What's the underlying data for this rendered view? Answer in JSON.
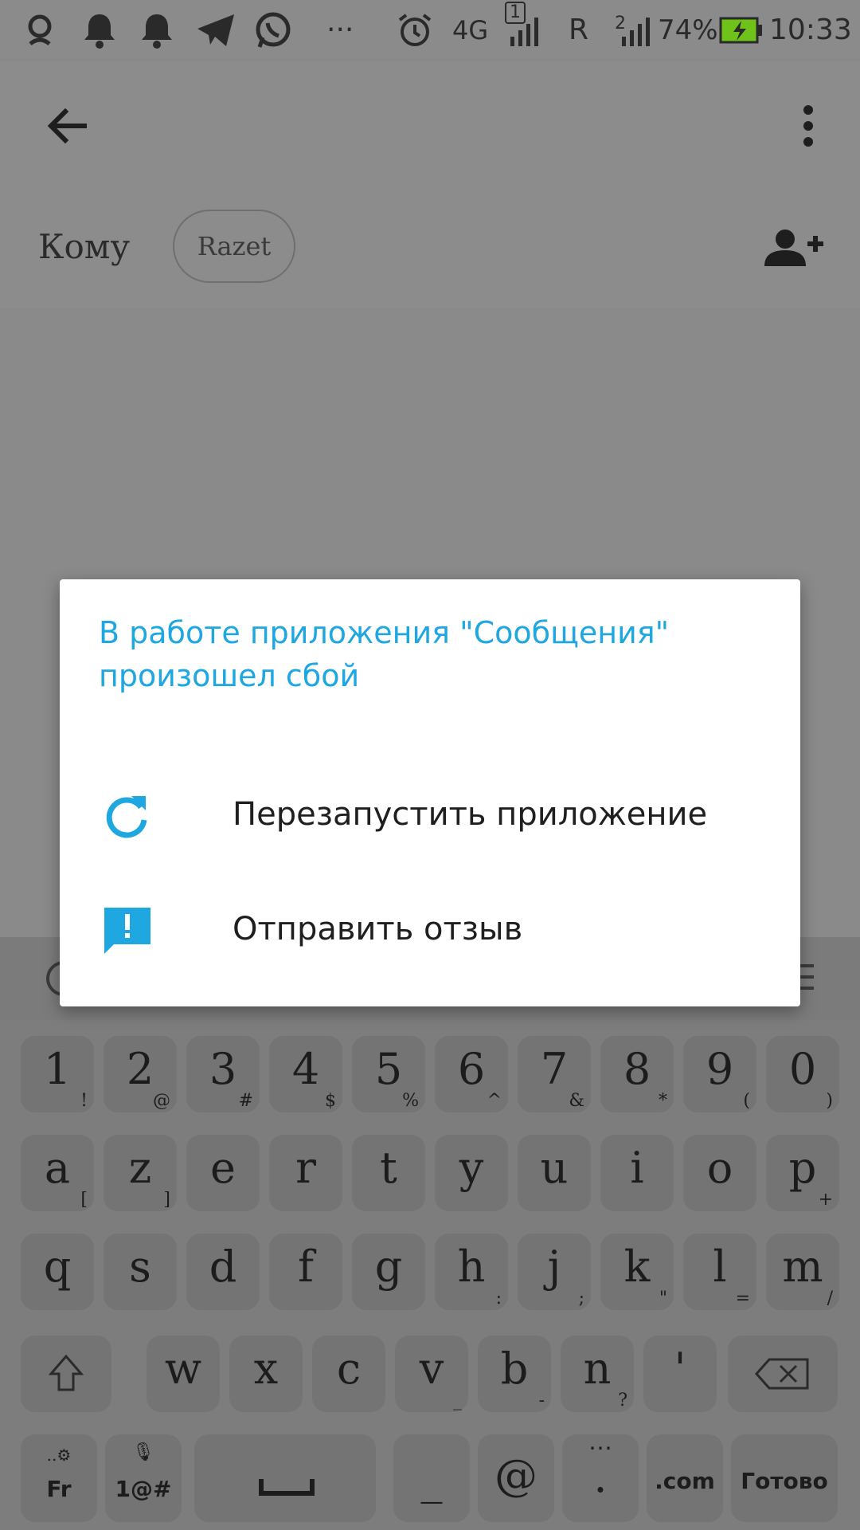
{
  "status_bar": {
    "network": "4G",
    "sim1_badge": "1",
    "roaming": "R",
    "sim2_badge": "2",
    "battery_percent": "74%",
    "time": "10:33",
    "overflow": "···"
  },
  "app_bar": {
    "to_label": "Кому",
    "recipient": "Razet"
  },
  "dialog": {
    "title": "В работе приложения \"Сообщения\" произошел сбой",
    "items": [
      {
        "label": "Перезапустить приложение",
        "icon": "refresh-icon"
      },
      {
        "label": "Отправить отзыв",
        "icon": "feedback-icon"
      }
    ],
    "accent_color": "#1ea7e0"
  },
  "keyboard": {
    "row1": [
      {
        "main": "1",
        "sub": "!"
      },
      {
        "main": "2",
        "sub": "@"
      },
      {
        "main": "3",
        "sub": "#"
      },
      {
        "main": "4",
        "sub": "$"
      },
      {
        "main": "5",
        "sub": "%"
      },
      {
        "main": "6",
        "sub": "^"
      },
      {
        "main": "7",
        "sub": "&"
      },
      {
        "main": "8",
        "sub": "*"
      },
      {
        "main": "9",
        "sub": "("
      },
      {
        "main": "0",
        "sub": ")"
      }
    ],
    "row2": [
      {
        "main": "a",
        "sub": "["
      },
      {
        "main": "z",
        "sub": "]"
      },
      {
        "main": "e",
        "sub": ""
      },
      {
        "main": "r",
        "sub": ""
      },
      {
        "main": "t",
        "sub": ""
      },
      {
        "main": "y",
        "sub": ""
      },
      {
        "main": "u",
        "sub": ""
      },
      {
        "main": "i",
        "sub": ""
      },
      {
        "main": "o",
        "sub": ""
      },
      {
        "main": "p",
        "sub": "+"
      }
    ],
    "row3": [
      {
        "main": "q",
        "sub": ""
      },
      {
        "main": "s",
        "sub": ""
      },
      {
        "main": "d",
        "sub": ""
      },
      {
        "main": "f",
        "sub": ""
      },
      {
        "main": "g",
        "sub": ""
      },
      {
        "main": "h",
        "sub": ":"
      },
      {
        "main": "j",
        "sub": ";"
      },
      {
        "main": "k",
        "sub": "\""
      },
      {
        "main": "l",
        "sub": "="
      },
      {
        "main": "m",
        "sub": "/"
      }
    ],
    "row4": [
      {
        "main": "w",
        "sub": ""
      },
      {
        "main": "x",
        "sub": ""
      },
      {
        "main": "c",
        "sub": ""
      },
      {
        "main": "v",
        "sub": "_"
      },
      {
        "main": "b",
        "sub": "-"
      },
      {
        "main": "n",
        "sub": "?"
      },
      {
        "main": "'",
        "sub": ""
      }
    ],
    "lang_key": "Fr",
    "symbols_key": "1@#",
    "at_key": "@",
    "dot_key": ".",
    "dotcom_key": ".com",
    "done_key": "Готово",
    "underscore_key": "_"
  }
}
